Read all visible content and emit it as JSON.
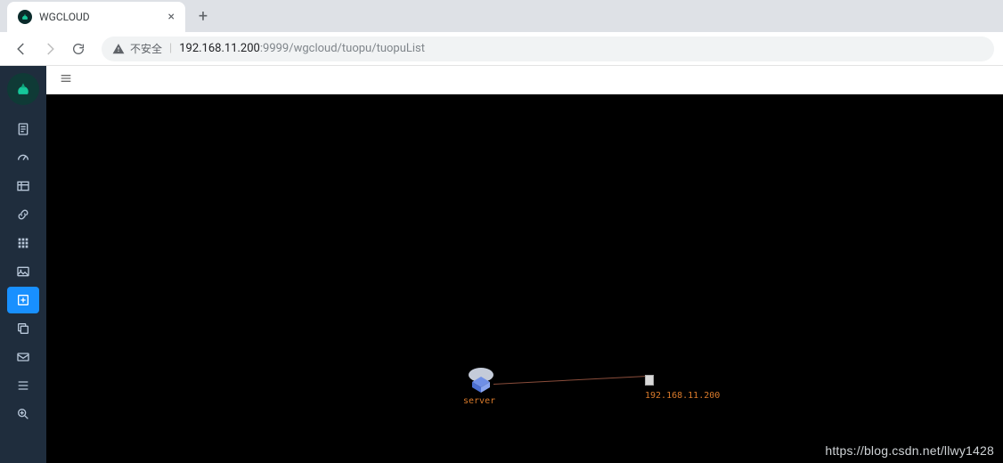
{
  "browser": {
    "tab_title": "WGCLOUD",
    "new_tab": "+",
    "close_tab": "×",
    "security_label": "不安全",
    "url_host": "192.168.11.200",
    "url_port_path": ":9999/wgcloud/tuopu/tuopuList"
  },
  "sidebar": {
    "items": [
      {
        "name": "nav-doc",
        "icon": "doc"
      },
      {
        "name": "nav-dashboard",
        "icon": "gauge"
      },
      {
        "name": "nav-table",
        "icon": "table"
      },
      {
        "name": "nav-link",
        "icon": "link"
      },
      {
        "name": "nav-grid",
        "icon": "grid"
      },
      {
        "name": "nav-image",
        "icon": "image"
      },
      {
        "name": "nav-topology",
        "icon": "plus-box",
        "active": true
      },
      {
        "name": "nav-copy",
        "icon": "copy"
      },
      {
        "name": "nav-mail",
        "icon": "mail"
      },
      {
        "name": "nav-list",
        "icon": "list"
      },
      {
        "name": "nav-search",
        "icon": "search-plus"
      }
    ]
  },
  "topology": {
    "server_label": "server",
    "host_label": "192.168.11.200"
  },
  "watermark": "https://blog.csdn.net/llwy1428"
}
